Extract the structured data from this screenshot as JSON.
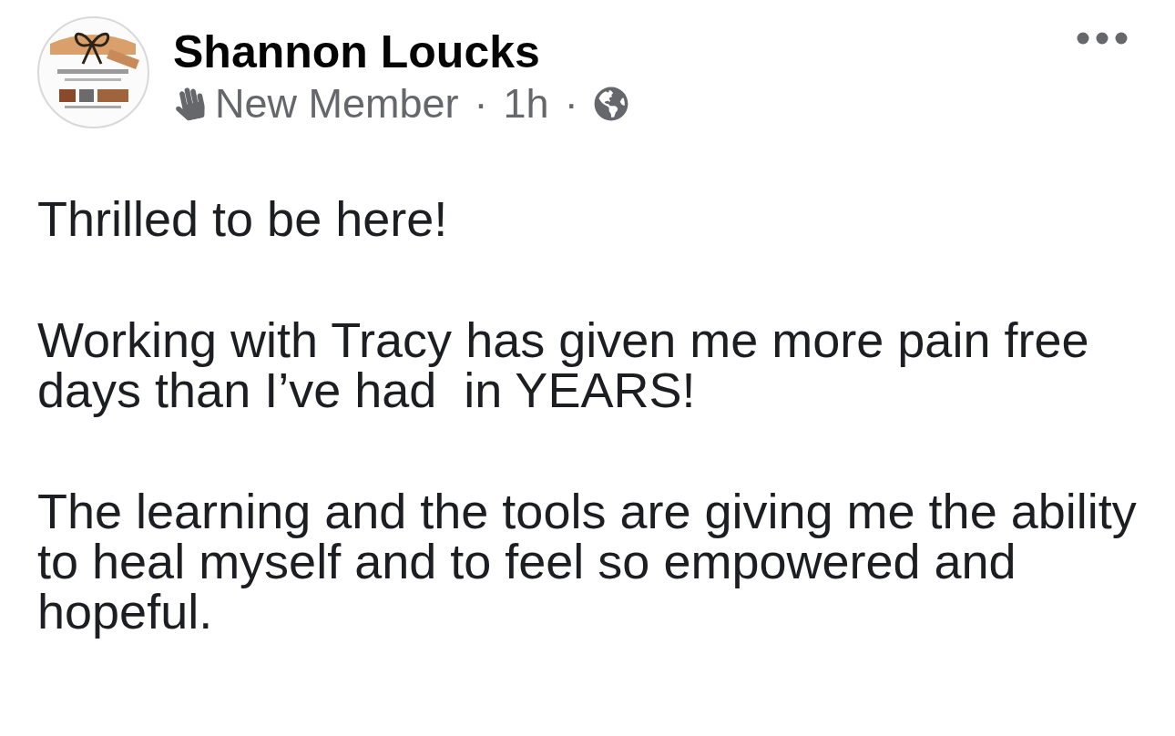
{
  "post": {
    "author": {
      "name": "Shannon Loucks"
    },
    "meta": [
      {
        "kind": "badge",
        "text": "New Member"
      },
      {
        "kind": "separator",
        "text": "·"
      },
      {
        "kind": "time",
        "text": "1h"
      },
      {
        "kind": "separator",
        "text": "·"
      },
      {
        "kind": "audience"
      }
    ],
    "paragraphs": [
      {
        "lines": [
          "Thrilled to be here!"
        ]
      },
      {
        "lines": [
          "Working with Tracy has given me more pain free",
          "days than I’ve had  in YEARS!"
        ]
      },
      {
        "lines": [
          "The learning and the tools are giving me the ability",
          "to heal myself and to feel so empowered and",
          "hopeful."
        ]
      }
    ]
  }
}
